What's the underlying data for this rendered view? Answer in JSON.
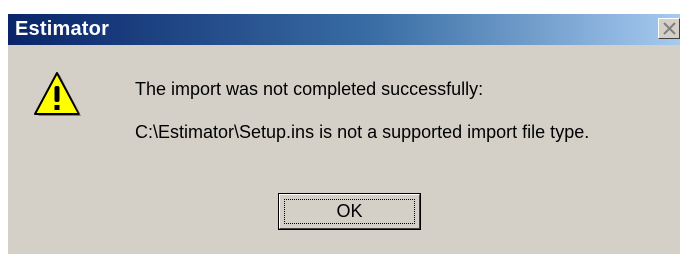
{
  "window": {
    "title": "Estimator",
    "close_icon": "close-icon"
  },
  "message": {
    "icon": "warning-icon",
    "line1": "The import was not completed successfully:",
    "line2": "C:\\Estimator\\Setup.ins is not a supported import file type."
  },
  "buttons": {
    "ok_label": "OK"
  },
  "colors": {
    "titlebar_start": "#0a246a",
    "titlebar_end": "#a6caf0",
    "face": "#d4d0c8",
    "warning_yellow": "#ffff00"
  }
}
